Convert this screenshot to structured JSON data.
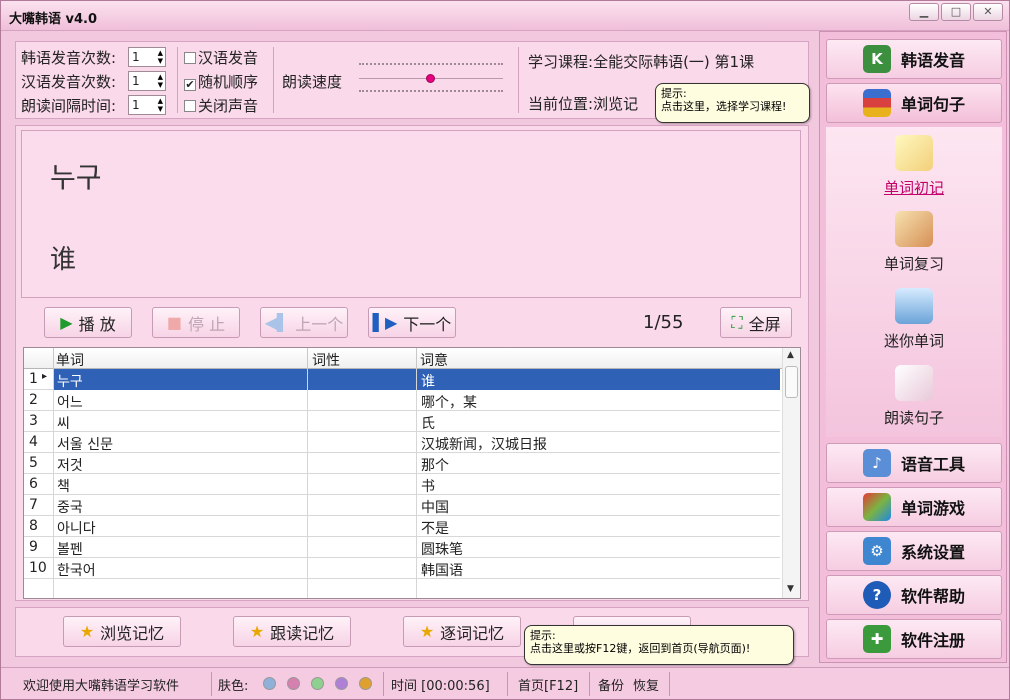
{
  "window": {
    "title": "大嘴韩语  v4.0",
    "min": "▁",
    "max": "□",
    "close": "✕"
  },
  "settings": {
    "korean_count_label": "韩语发音次数:",
    "korean_count": "1",
    "chinese_count_label": "汉语发音次数:",
    "chinese_count": "1",
    "interval_label": "朗读间隔时间:",
    "interval": "1",
    "opt_chinese": "汉语发音",
    "opt_random": "随机顺序",
    "opt_mute": "关闭声音",
    "opt_chinese_checked": false,
    "opt_random_checked": true,
    "opt_mute_checked": false,
    "speed_label": "朗读速度",
    "speed_level": 0.5
  },
  "course": {
    "label": "学习课程:",
    "value": "全能交际韩语(一) 第1课",
    "position_label": "当前位置:",
    "position_value": "浏览记"
  },
  "tip_course": {
    "title": "提示:",
    "text": "点击这里，选择学习课程!"
  },
  "display": {
    "korean": "누구",
    "chinese": "谁"
  },
  "controls": {
    "play": "播 放",
    "stop": "停 止",
    "prev": "上一个",
    "next": "下一个",
    "counter": "1/55",
    "fullscreen": "全屏"
  },
  "table": {
    "headers": [
      "单词",
      "词性",
      "词意"
    ],
    "rows": [
      {
        "n": "1",
        "word": "누구",
        "pos": "",
        "meaning": "谁"
      },
      {
        "n": "2",
        "word": "어느",
        "pos": "",
        "meaning": "哪个，某"
      },
      {
        "n": "3",
        "word": "씨",
        "pos": "",
        "meaning": "氏"
      },
      {
        "n": "4",
        "word": "서울 신문",
        "pos": "",
        "meaning": "汉城新闻，汉城日报"
      },
      {
        "n": "5",
        "word": "저것",
        "pos": "",
        "meaning": "那个"
      },
      {
        "n": "6",
        "word": "책",
        "pos": "",
        "meaning": "书"
      },
      {
        "n": "7",
        "word": "중국",
        "pos": "",
        "meaning": "中国"
      },
      {
        "n": "8",
        "word": "아니다",
        "pos": "",
        "meaning": "不是"
      },
      {
        "n": "9",
        "word": "볼펜",
        "pos": "",
        "meaning": "圆珠笔"
      },
      {
        "n": "10",
        "word": "한국어",
        "pos": "",
        "meaning": "韩国语"
      }
    ]
  },
  "bottom": {
    "browse": "浏览记忆",
    "follow": "跟读记忆",
    "word_by_word": "逐词记忆"
  },
  "tip_home": {
    "title": "提示:",
    "text": "点击这里或按F12键，返回到首页(导航页面)!"
  },
  "nav": {
    "korean_pron": "韩语发音",
    "word_sentence": "单词句子",
    "sub": [
      "单词初记",
      "单词复习",
      "迷你单词",
      "朗读句子"
    ],
    "voice_tools": "语音工具",
    "word_games": "单词游戏",
    "settings": "系统设置",
    "help": "软件帮助",
    "register": "软件注册"
  },
  "status": {
    "welcome": "欢迎使用大嘴韩语学习软件",
    "skin_label": "肤色:",
    "skin_colors": [
      "#8fb0d8",
      "#d680b0",
      "#8fcf8f",
      "#b07fd8",
      "#e0a030"
    ],
    "time": "时间 [00:00:56]",
    "home": "首页[F12]",
    "backup": "备份",
    "restore": "恢复"
  }
}
